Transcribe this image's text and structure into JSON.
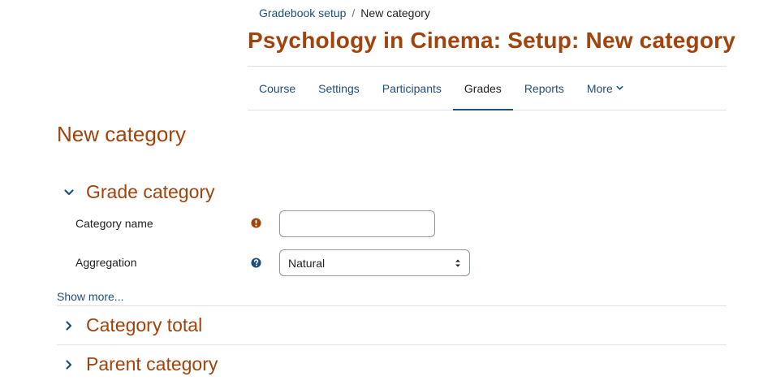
{
  "breadcrumb": {
    "items": [
      "Gradebook setup",
      "New category"
    ],
    "separator": "/"
  },
  "page_title": "Psychology in Cinema: Setup: New category",
  "nav": {
    "tabs": [
      {
        "label": "Course"
      },
      {
        "label": "Settings"
      },
      {
        "label": "Participants"
      },
      {
        "label": "Grades",
        "active": true
      },
      {
        "label": "Reports"
      },
      {
        "label": "More"
      }
    ]
  },
  "form": {
    "heading": "New category",
    "sections": [
      {
        "title": "Grade category",
        "expanded": true
      },
      {
        "title": "Category total",
        "expanded": false
      },
      {
        "title": "Parent category",
        "expanded": false
      }
    ],
    "fields": {
      "category_name": {
        "label": "Category name",
        "value": "",
        "icon": "required-icon"
      },
      "aggregation": {
        "label": "Aggregation",
        "value": "Natural",
        "icon": "help-icon"
      }
    },
    "show_more": "Show more..."
  },
  "colors": {
    "brand_heading": "#a0430d",
    "link": "#1f4e79",
    "required": "#a0430d",
    "help": "#1f4e79"
  }
}
